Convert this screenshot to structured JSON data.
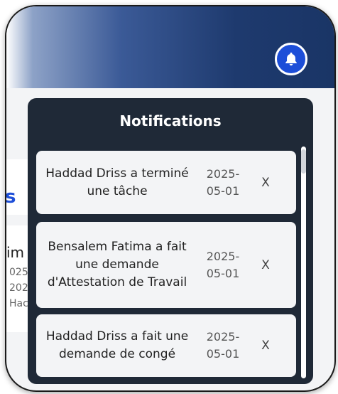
{
  "colors": {
    "navbar": "#1e3a6e",
    "bell": "#1d4ed8",
    "panel": "#1f2937",
    "card": "#f3f4f6"
  },
  "header": {
    "bell_icon": "bell-icon"
  },
  "background": {
    "heading_fragment": "s",
    "line1": "im",
    "line2": "025",
    "line3": "202",
    "line4": "Hac"
  },
  "notifications": {
    "title": "Notifications",
    "items": [
      {
        "message": "Haddad Driss a terminé une tâche",
        "date": "2025-05-01",
        "dismiss": "X"
      },
      {
        "message": "Bensalem Fatima a fait une demande d'Attestation de Travail",
        "date": "2025-05-01",
        "dismiss": "X"
      },
      {
        "message": "Haddad Driss a fait une demande de congé",
        "date": "2025-05-01",
        "dismiss": "X"
      }
    ]
  }
}
